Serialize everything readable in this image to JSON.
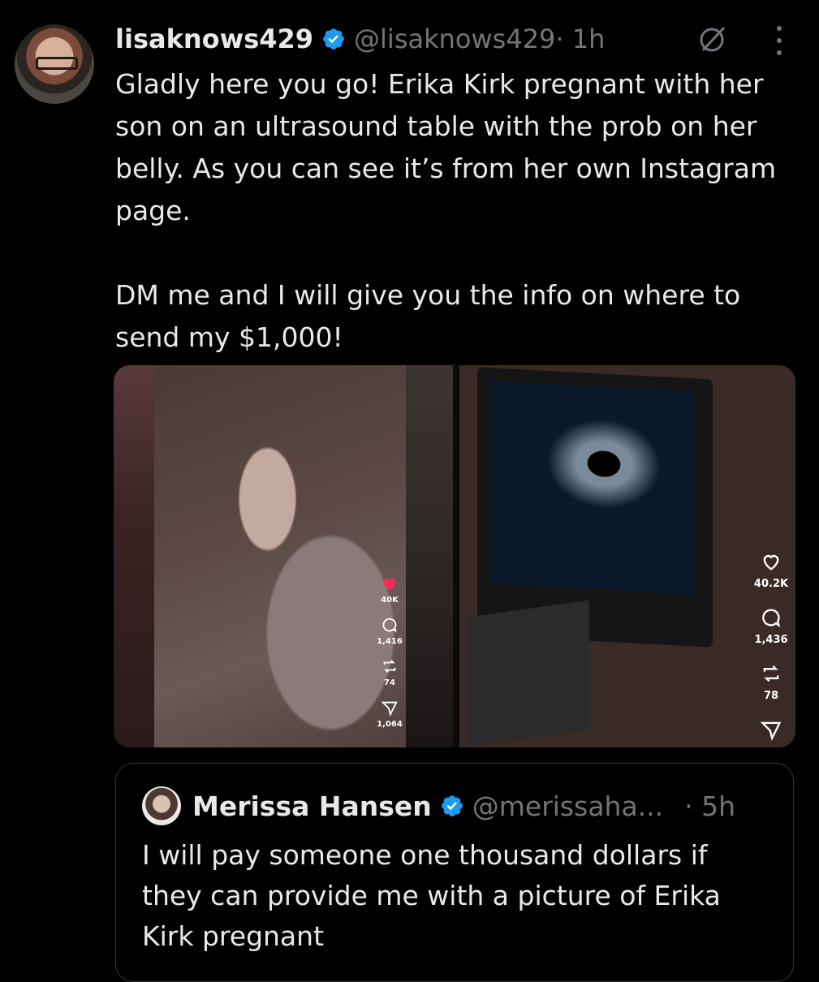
{
  "tweet": {
    "display_name": "lisaknows429",
    "handle": "@lisaknows429",
    "time": " · 1h",
    "text": "Gladly here you go! Erika Kirk pregnant with her son on an ultrasound table with the prob on her belly. As you can see it’s from her own Instagram page.\n\nDM me and I will give you the info on where to send my $1,000!",
    "icons": {
      "verified": "verified-badge-icon",
      "grok": "grok-icon",
      "more": "more-icon"
    },
    "colors": {
      "accent": "#1d9bf0",
      "muted": "#71767b",
      "text": "#e7e9ea",
      "background": "#000000"
    }
  },
  "media": {
    "left_video": {
      "likes": "40K",
      "comments": "1,416",
      "reposts": "74",
      "shares": "1,064"
    },
    "right_video": {
      "likes": "40.2K",
      "comments": "1,436",
      "reposts": "78"
    }
  },
  "quote": {
    "display_name": "Merissa Hansen",
    "handle": "@merissaha...",
    "time": "· 5h",
    "text": "I will pay someone one thousand dollars if they can provide me with a picture of Erika Kirk pregnant"
  }
}
